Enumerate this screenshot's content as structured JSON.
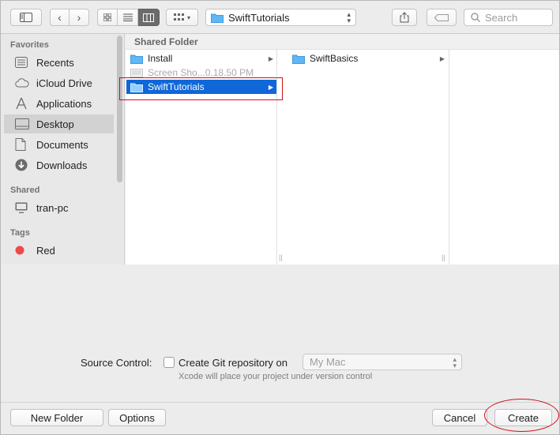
{
  "toolbar": {
    "path_folder": "SwiftTutorials",
    "search_placeholder": "Search"
  },
  "sidebar": {
    "sections": {
      "favorites": "Favorites",
      "shared": "Shared",
      "tags": "Tags"
    },
    "favorites": [
      {
        "label": "Recents",
        "icon": "recents-icon"
      },
      {
        "label": "iCloud Drive",
        "icon": "cloud-icon"
      },
      {
        "label": "Applications",
        "icon": "applications-icon"
      },
      {
        "label": "Desktop",
        "icon": "desktop-icon",
        "selected": true
      },
      {
        "label": "Documents",
        "icon": "documents-icon"
      },
      {
        "label": "Downloads",
        "icon": "downloads-icon"
      }
    ],
    "shared": [
      {
        "label": "tran-pc",
        "icon": "computer-icon"
      }
    ],
    "tags": [
      {
        "label": "Red",
        "color": "#f0484d"
      }
    ]
  },
  "browser": {
    "header": "Shared Folder",
    "column1": [
      {
        "name": "Install"
      },
      {
        "name": "Screen Sho...0.18.50 PM"
      },
      {
        "name": "SwiftTutorials"
      }
    ],
    "column2": [
      {
        "name": "SwiftBasics"
      }
    ]
  },
  "options": {
    "source_control_label": "Source Control:",
    "checkbox_label": "Create Git repository on",
    "repo_location": "My Mac",
    "hint": "Xcode will place your project under version control"
  },
  "buttons": {
    "new_folder": "New Folder",
    "options": "Options",
    "cancel": "Cancel",
    "create": "Create"
  },
  "colors": {
    "selection": "#0f67d8",
    "highlight_annotation": "#d0101a",
    "folder": "#5fb7f5"
  }
}
